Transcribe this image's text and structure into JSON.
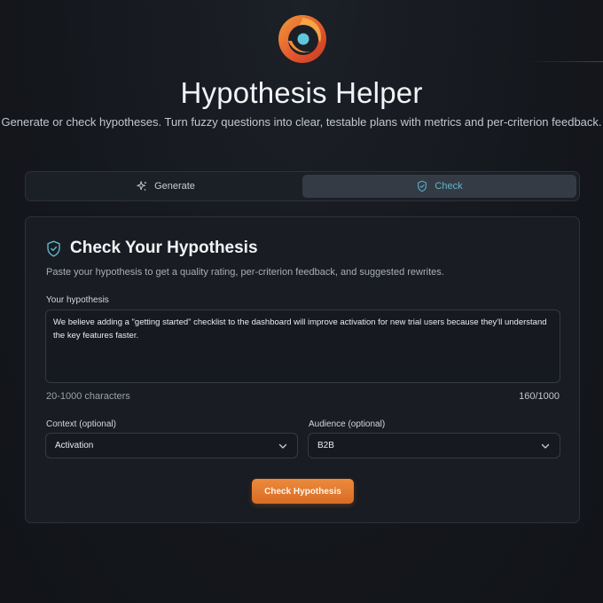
{
  "header": {
    "logo_icon": "eye-flame-logo-icon",
    "title": "Hypothesis Helper",
    "subtitle": "Generate or check hypotheses. Turn fuzzy questions into clear, testable plans with metrics and per-criterion feedback."
  },
  "tabs": [
    {
      "label": "Generate",
      "icon": "sparkles-icon",
      "active": false
    },
    {
      "label": "Check",
      "icon": "shield-check-icon",
      "active": true
    }
  ],
  "card": {
    "icon": "shield-check-icon",
    "title": "Check Your Hypothesis",
    "description": "Paste your hypothesis to get a quality rating, per-criterion feedback, and suggested rewrites.",
    "hypothesis_label": "Your hypothesis",
    "hypothesis_value": "We believe adding a \"getting started\" checklist to the dashboard will improve activation for new trial users because they'll understand the key features faster.",
    "hint": "20-1000 characters",
    "counter": "160/1000",
    "context_label": "Context (optional)",
    "context_value": "Activation",
    "audience_label": "Audience (optional)",
    "audience_value": "B2B",
    "submit_label": "Check Hypothesis"
  },
  "colors": {
    "accent_orange": "#e47a2f",
    "accent_teal": "#5fb6cc",
    "background": "#15181e"
  }
}
